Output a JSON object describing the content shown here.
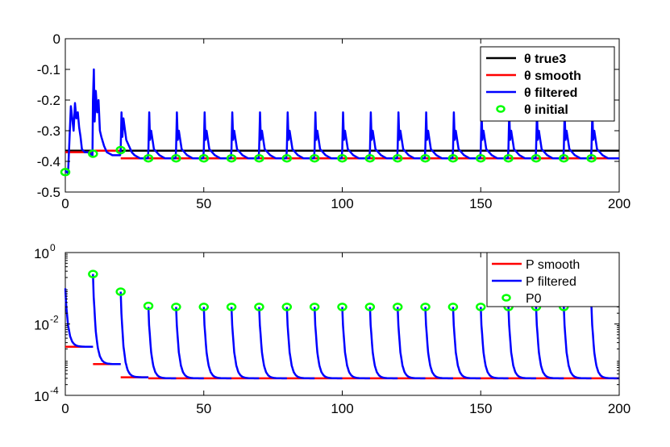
{
  "chart_data": [
    {
      "type": "line",
      "title": "",
      "xlabel": "",
      "ylabel": "",
      "xlim": [
        0,
        200
      ],
      "ylim": [
        -0.5,
        0
      ],
      "x_ticks": [
        "0",
        "50",
        "100",
        "150",
        "200"
      ],
      "y_ticks": [
        "0",
        "-0.1",
        "-0.2",
        "-0.3",
        "-0.4",
        "-0.5"
      ],
      "legend_position": "top-right",
      "legend": [
        "θ true3",
        "θ smooth",
        "θ filtered",
        "θ initial"
      ],
      "series": [
        {
          "name": "θ true3",
          "color": "#000000",
          "x": [
            0,
            200
          ],
          "values": [
            -0.365,
            -0.365
          ]
        },
        {
          "name": "θ smooth",
          "color": "#ff0000",
          "steps": [
            {
              "x_start": 0,
              "x_end": 10,
              "value": -0.37
            },
            {
              "x_start": 10,
              "x_end": 20,
              "value": -0.365
            },
            {
              "x_start": 20,
              "x_end": 200,
              "value": -0.39
            }
          ]
        },
        {
          "name": "θ filtered",
          "color": "#0000ff",
          "x": [
            0,
            1,
            2,
            3,
            3.5,
            4,
            4.5,
            5,
            5.5,
            6,
            7,
            8,
            9,
            9.8,
            10,
            10.3,
            10.6,
            11,
            11.5,
            12,
            12.5,
            13,
            14,
            15,
            16,
            17,
            18,
            19,
            19.8,
            20,
            20.3,
            20.6,
            21,
            22,
            23,
            24,
            25,
            26,
            27,
            28,
            29,
            29.8,
            30,
            30.3,
            30.6,
            31,
            32,
            33,
            34,
            35,
            36,
            37,
            38,
            39,
            39.8,
            40,
            40.3,
            40.6,
            41,
            42,
            43,
            44,
            45,
            46,
            47,
            48,
            49,
            49.8,
            50,
            50.3,
            50.6,
            51,
            52,
            53,
            54,
            55,
            56,
            57,
            58,
            59,
            59.8,
            60,
            60.3,
            60.6,
            61,
            62,
            63,
            64,
            65,
            66,
            67,
            68,
            69,
            69.8,
            70,
            70.3,
            70.6,
            71,
            72,
            73,
            74,
            75,
            76,
            77,
            78,
            79,
            79.8,
            80,
            80.3,
            80.6,
            81,
            82,
            83,
            84,
            85,
            86,
            87,
            88,
            89,
            89.8,
            90,
            90.3,
            90.6,
            91,
            92,
            93,
            94,
            95,
            96,
            97,
            98,
            99,
            99.8,
            100,
            100.3,
            100.6,
            101,
            102,
            103,
            104,
            105,
            106,
            107,
            108,
            109,
            109.8,
            110,
            110.3,
            110.6,
            111,
            112,
            113,
            114,
            115,
            116,
            117,
            118,
            119,
            119.8,
            120,
            120.3,
            120.6,
            121,
            122,
            123,
            124,
            125,
            126,
            127,
            128,
            129,
            129.8,
            130,
            130.3,
            130.6,
            131,
            132,
            133,
            134,
            135,
            136,
            137,
            138,
            139,
            139.8,
            140,
            140.3,
            140.6,
            141,
            142,
            143,
            144,
            145,
            146,
            147,
            148,
            149,
            149.8,
            150,
            150.3,
            150.6,
            151,
            152,
            153,
            154,
            155,
            156,
            157,
            158,
            159,
            159.8,
            160,
            160.3,
            160.6,
            161,
            162,
            163,
            164,
            165,
            166,
            167,
            168,
            169,
            169.8,
            170,
            170.3,
            170.6,
            171,
            172,
            173,
            174,
            175,
            176,
            177,
            178,
            179,
            179.8,
            180,
            180.3,
            180.6,
            181,
            182,
            183,
            184,
            185,
            186,
            187,
            188,
            189,
            189.8,
            190,
            190.3,
            190.6,
            191,
            192,
            193,
            194,
            195,
            196,
            197,
            198,
            199,
            200
          ],
          "values": [
            -0.43,
            -0.44,
            -0.22,
            -0.3,
            -0.21,
            -0.26,
            -0.24,
            -0.29,
            -0.32,
            -0.36,
            -0.37,
            -0.37,
            -0.375,
            -0.38,
            -0.2,
            -0.1,
            -0.27,
            -0.17,
            -0.24,
            -0.2,
            -0.3,
            -0.32,
            -0.35,
            -0.37,
            -0.375,
            -0.38,
            -0.38,
            -0.38,
            -0.38,
            -0.36,
            -0.24,
            -0.32,
            -0.26,
            -0.33,
            -0.35,
            -0.37,
            -0.38,
            -0.385,
            -0.39,
            -0.39,
            -0.39,
            -0.39,
            -0.36,
            -0.24,
            -0.33,
            -0.3,
            -0.36,
            -0.37,
            -0.38,
            -0.385,
            -0.39,
            -0.39,
            -0.39,
            -0.39,
            -0.39,
            -0.36,
            -0.24,
            -0.33,
            -0.3,
            -0.36,
            -0.37,
            -0.38,
            -0.385,
            -0.39,
            -0.39,
            -0.39,
            -0.39,
            -0.39,
            -0.36,
            -0.24,
            -0.33,
            -0.3,
            -0.36,
            -0.37,
            -0.38,
            -0.385,
            -0.39,
            -0.39,
            -0.39,
            -0.39,
            -0.39,
            -0.36,
            -0.24,
            -0.33,
            -0.3,
            -0.36,
            -0.37,
            -0.38,
            -0.385,
            -0.39,
            -0.39,
            -0.39,
            -0.39,
            -0.39,
            -0.36,
            -0.24,
            -0.33,
            -0.3,
            -0.36,
            -0.37,
            -0.38,
            -0.385,
            -0.39,
            -0.39,
            -0.39,
            -0.39,
            -0.39,
            -0.36,
            -0.24,
            -0.33,
            -0.3,
            -0.36,
            -0.37,
            -0.38,
            -0.385,
            -0.39,
            -0.39,
            -0.39,
            -0.39,
            -0.39,
            -0.36,
            -0.24,
            -0.33,
            -0.3,
            -0.36,
            -0.37,
            -0.38,
            -0.385,
            -0.39,
            -0.39,
            -0.39,
            -0.39,
            -0.39,
            -0.36,
            -0.24,
            -0.33,
            -0.3,
            -0.36,
            -0.37,
            -0.38,
            -0.385,
            -0.39,
            -0.39,
            -0.39,
            -0.39,
            -0.39,
            -0.36,
            -0.24,
            -0.33,
            -0.3,
            -0.36,
            -0.37,
            -0.38,
            -0.385,
            -0.39,
            -0.39,
            -0.39,
            -0.39,
            -0.39,
            -0.36,
            -0.24,
            -0.33,
            -0.3,
            -0.36,
            -0.37,
            -0.38,
            -0.385,
            -0.39,
            -0.39,
            -0.39,
            -0.39,
            -0.39,
            -0.36,
            -0.24,
            -0.33,
            -0.3,
            -0.36,
            -0.37,
            -0.38,
            -0.385,
            -0.39,
            -0.39,
            -0.39,
            -0.39,
            -0.39,
            -0.36,
            -0.24,
            -0.33,
            -0.3,
            -0.36,
            -0.37,
            -0.38,
            -0.385,
            -0.39,
            -0.39,
            -0.39,
            -0.39,
            -0.39,
            -0.36,
            -0.24,
            -0.33,
            -0.3,
            -0.36,
            -0.37,
            -0.38,
            -0.385,
            -0.39,
            -0.39,
            -0.39,
            -0.39,
            -0.39,
            -0.36,
            -0.24,
            -0.33,
            -0.3,
            -0.36,
            -0.37,
            -0.38,
            -0.385,
            -0.39,
            -0.39,
            -0.39,
            -0.39,
            -0.39,
            -0.36,
            -0.24,
            -0.33,
            -0.3,
            -0.36,
            -0.37,
            -0.38,
            -0.385,
            -0.39,
            -0.39,
            -0.39,
            -0.39,
            -0.39,
            -0.36,
            -0.24,
            -0.33,
            -0.3,
            -0.36,
            -0.37,
            -0.38,
            -0.385,
            -0.39,
            -0.39,
            -0.39,
            -0.39,
            -0.39,
            -0.36,
            -0.24,
            -0.33,
            -0.3,
            -0.36,
            -0.37,
            -0.38,
            -0.385,
            -0.39,
            -0.39,
            -0.39,
            -0.39,
            -0.39
          ]
        },
        {
          "name": "θ initial",
          "color": "#00ff00",
          "marker": "circle",
          "x": [
            0,
            10,
            20,
            30,
            40,
            50,
            60,
            70,
            80,
            90,
            100,
            110,
            120,
            130,
            140,
            150,
            160,
            170,
            180,
            190
          ],
          "values": [
            -0.435,
            -0.375,
            -0.363,
            -0.39,
            -0.39,
            -0.39,
            -0.39,
            -0.39,
            -0.39,
            -0.39,
            -0.39,
            -0.39,
            -0.39,
            -0.39,
            -0.39,
            -0.39,
            -0.39,
            -0.39,
            -0.39,
            -0.39
          ]
        }
      ]
    },
    {
      "type": "line",
      "title": "",
      "xlabel": "",
      "ylabel": "",
      "xlim": [
        0,
        200
      ],
      "ylim": [
        0.0001,
        1
      ],
      "y_scale": "log",
      "x_ticks": [
        "0",
        "50",
        "100",
        "150",
        "200"
      ],
      "y_ticks": [
        {
          "base": "10",
          "exp": "0"
        },
        {
          "base": "10",
          "exp": "-2"
        },
        {
          "base": "10",
          "exp": "-4"
        }
      ],
      "legend_position": "top-right",
      "legend": [
        "P smooth",
        "P filtered",
        "P0"
      ],
      "series": [
        {
          "name": "P smooth",
          "color": "#ff0000",
          "steps": [
            {
              "x_start": 0,
              "x_end": 10,
              "value": 0.0023
            },
            {
              "x_start": 10,
              "x_end": 20,
              "value": 0.00075
            },
            {
              "x_start": 20,
              "x_end": 30,
              "value": 0.00032
            },
            {
              "x_start": 30,
              "x_end": 200,
              "value": 0.0003
            }
          ]
        },
        {
          "name": "P filtered",
          "color": "#0000ff",
          "decays": [
            {
              "x_start": 0,
              "x_end": 10,
              "start": 0.1,
              "end": 0.0023
            },
            {
              "x_start": 10,
              "x_end": 20,
              "start": 0.25,
              "end": 0.00075
            },
            {
              "x_start": 20,
              "x_end": 30,
              "start": 0.08,
              "end": 0.00032
            },
            {
              "x_start": 30,
              "x_end": 40,
              "start": 0.03,
              "end": 0.0003
            },
            {
              "x_start": 40,
              "x_end": 50,
              "start": 0.03,
              "end": 0.0003
            },
            {
              "x_start": 50,
              "x_end": 60,
              "start": 0.03,
              "end": 0.0003
            },
            {
              "x_start": 60,
              "x_end": 70,
              "start": 0.03,
              "end": 0.0003
            },
            {
              "x_start": 70,
              "x_end": 80,
              "start": 0.03,
              "end": 0.0003
            },
            {
              "x_start": 80,
              "x_end": 90,
              "start": 0.03,
              "end": 0.0003
            },
            {
              "x_start": 90,
              "x_end": 100,
              "start": 0.03,
              "end": 0.0003
            },
            {
              "x_start": 100,
              "x_end": 110,
              "start": 0.03,
              "end": 0.0003
            },
            {
              "x_start": 110,
              "x_end": 120,
              "start": 0.03,
              "end": 0.0003
            },
            {
              "x_start": 120,
              "x_end": 130,
              "start": 0.03,
              "end": 0.0003
            },
            {
              "x_start": 130,
              "x_end": 140,
              "start": 0.03,
              "end": 0.0003
            },
            {
              "x_start": 140,
              "x_end": 150,
              "start": 0.03,
              "end": 0.0003
            },
            {
              "x_start": 150,
              "x_end": 160,
              "start": 0.03,
              "end": 0.0003
            },
            {
              "x_start": 160,
              "x_end": 170,
              "start": 0.03,
              "end": 0.0003
            },
            {
              "x_start": 170,
              "x_end": 180,
              "start": 0.03,
              "end": 0.0003
            },
            {
              "x_start": 180,
              "x_end": 190,
              "start": 0.03,
              "end": 0.0003
            },
            {
              "x_start": 190,
              "x_end": 200,
              "start": 0.03,
              "end": 0.0003
            }
          ]
        },
        {
          "name": "P0",
          "color": "#00ff00",
          "marker": "circle",
          "x": [
            10,
            20,
            30,
            40,
            50,
            60,
            70,
            80,
            90,
            100,
            110,
            120,
            130,
            140,
            150,
            160,
            170,
            180
          ],
          "values": [
            0.25,
            0.08,
            0.032,
            0.03,
            0.03,
            0.03,
            0.03,
            0.03,
            0.03,
            0.03,
            0.03,
            0.03,
            0.03,
            0.03,
            0.03,
            0.03,
            0.03,
            0.03
          ]
        }
      ]
    }
  ]
}
